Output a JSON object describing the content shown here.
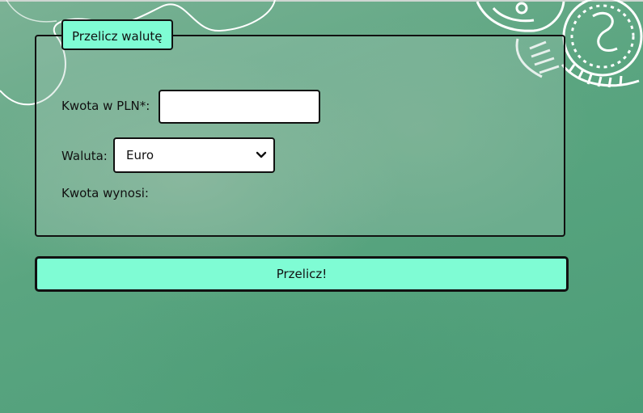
{
  "form": {
    "legend": "Przelicz walutę",
    "amount_label": "Kwota w PLN*:",
    "amount_value": "",
    "currency_label": "Waluta:",
    "currency_selected": "Euro",
    "result_label": "Kwota wynosi:",
    "result_value": ""
  },
  "submit": {
    "label": "Przelicz!"
  },
  "colors": {
    "accent": "#7ffcd4",
    "background": "#5aa580",
    "border": "#111111"
  },
  "icons": {
    "decoration_left": "swirl-line",
    "decoration_right": "coins",
    "select_arrow": "chevron-down"
  }
}
